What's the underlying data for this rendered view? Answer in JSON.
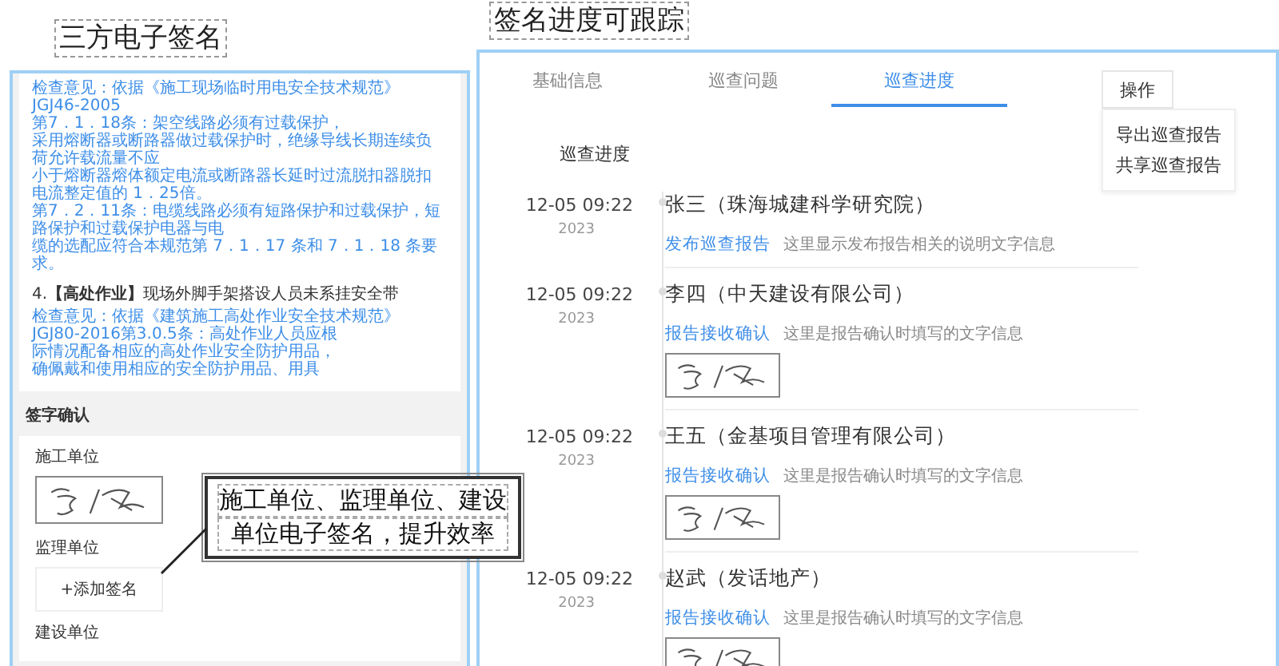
{
  "left_title": "三方电子签名",
  "right_title": "签名进度可跟踪",
  "callout": {
    "lines": [
      "施工单位、监理单位、建设",
      "单位电子签名，提升效率"
    ]
  },
  "inspection": {
    "basis_lines": [
      "检查意见：依据《施工现场临时用电安全技术规范》",
      "JGJ46-2005",
      "第7．1．18条：架空线路必须有过载保护，",
      "采用熔断器或断路器做过载保护时，绝缘导线长期连续负",
      "荷允许载流量不应",
      "小于熔断器熔体额定电流或断路器长延时过流脱扣器脱扣",
      "电流整定值的 1．25倍。",
      "第7．2．11条：电缆线路必须有短路保护和过载保护，短",
      "路保护和过载保护电器与电",
      "缆的选配应符合本规范第 7．1．17 条和 7．1．18 条要",
      "求。"
    ],
    "item": "4.**【高处作业】**现场外脚手架搭设人员未系挂安全带",
    "item_basis_lines": [
      "检查意见：依据《建筑施工高处作业安全技术规范》",
      "JGJ80-2016第3.0.5条：高处作业人员应根",
      "际情况配备相应的高处作业安全防护用品，",
      "确佩戴和使用相应的安全防护用品、用具"
    ]
  },
  "sign_section": {
    "title": "签字确认",
    "parties": [
      {
        "label": "施工单位",
        "signed": true
      },
      {
        "label": "监理单位",
        "signed": false,
        "add_label": "+添加签名"
      },
      {
        "label": "建设单位"
      }
    ]
  },
  "tabs": [
    {
      "label": "基础信息",
      "selected": false
    },
    {
      "label": "巡查问题",
      "selected": false
    },
    {
      "label": "巡查进度",
      "selected": true
    }
  ],
  "action_button": "操作",
  "action_menu": [
    "导出巡查报告",
    "共享巡查报告"
  ],
  "progress_title": "巡查进度",
  "timeline": [
    {
      "time": "12-05 09:22",
      "year": "2023",
      "name": "张三（珠海城建科学研究院）",
      "action": "发布巡查报告",
      "note": "这里显示发布报告相关的说明文字信息",
      "signed": false
    },
    {
      "time": "12-05 09:22",
      "year": "2023",
      "name": "李四（中天建设有限公司）",
      "action": "报告接收确认",
      "note": "这里是报告确认时填写的文字信息",
      "signed": true
    },
    {
      "time": "12-05 09:22",
      "year": "2023",
      "name": "王五（金基项目管理有限公司）",
      "action": "报告接收确认",
      "note": "这里是报告确认时填写的文字信息",
      "signed": true
    },
    {
      "time": "12-05 09:22",
      "year": "2023",
      "name": "赵武（发话地产）",
      "action": "报告接收确认",
      "note": "这里是报告确认时填写的文字信息",
      "signed": true
    }
  ]
}
